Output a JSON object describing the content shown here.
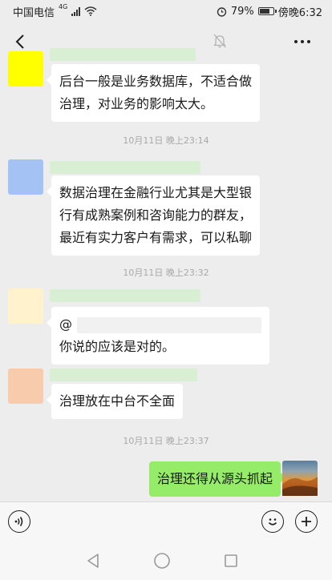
{
  "status_bar": {
    "carrier": "中国电信",
    "network": "4G",
    "battery": "79%",
    "battery_level": 0.79,
    "time": "傍晚6:32"
  },
  "messages": [
    {
      "sender": "other",
      "lines": [
        "后台一般是业务数据库，不适合做",
        "治理，对业务的影响太大。"
      ]
    },
    {
      "sender": "other",
      "lines": [
        "数据治理在金融行业尤其是大型银",
        "行有成熟案例和咨询能力的群友，",
        "最近有实力客户有需求，可以私聊"
      ]
    },
    {
      "sender": "other",
      "mention_prefix": "@",
      "lines": [
        "你说的应该是对的。"
      ]
    },
    {
      "sender": "other",
      "lines": [
        "治理放在中台不全面"
      ]
    },
    {
      "sender": "me",
      "lines": [
        "治理还得从源头抓起"
      ]
    }
  ],
  "timestamps": [
    "10月11日 晚上23:14",
    "10月11日 晚上23:32",
    "10月11日 晚上23:37"
  ],
  "colors": {
    "background": "#ededed",
    "bubble_other": "#ffffff",
    "bubble_me": "#95ec69",
    "avatar_1": "#ffff00",
    "avatar_2": "#a4c2f4",
    "avatar_3": "#fff2cc",
    "avatar_4": "#f9cbad"
  },
  "icons": [
    "back-arrow-icon",
    "mute-bell-icon",
    "more-dots-icon",
    "voice-icon",
    "emoji-icon",
    "plus-icon",
    "nav-back-icon",
    "nav-home-icon",
    "nav-recent-icon"
  ]
}
